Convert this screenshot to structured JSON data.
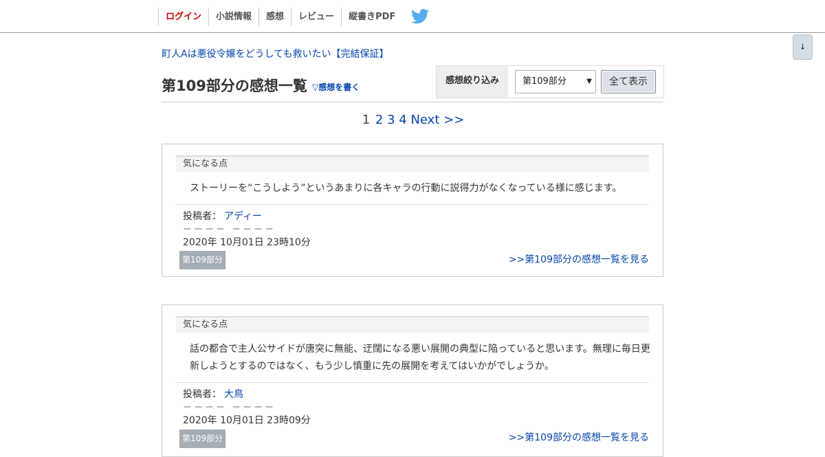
{
  "nav": {
    "items": [
      {
        "label": "ログイン"
      },
      {
        "label": "小説情報"
      },
      {
        "label": "感想"
      },
      {
        "label": "レビュー"
      },
      {
        "label": "縦書きPDF"
      }
    ]
  },
  "scroll_button": "↓",
  "novel_title": "町人Aは悪役令嬢をどうしても救いたい【完結保証】",
  "page_title": "第109部分の感想一覧",
  "write_link": "▽感想を書く",
  "filter": {
    "label": "感想絞り込み",
    "selected": "第109部分",
    "show_all": "全て表示"
  },
  "pager": {
    "current": "1",
    "pages": [
      "2",
      "3",
      "4"
    ],
    "next": "Next >>"
  },
  "comments": [
    {
      "section": "気になる点",
      "body": "ストーリーを“こうしよう”というあまりに各キャラの行動に説得力がなくなっている様に感じます。",
      "author_label": "投稿者：",
      "author": "アディー",
      "dashes": "－－－－ －－－－",
      "date": "2020年 10月01日 23時10分",
      "part": "第109部分",
      "view_link": ">>第109部分の感想一覧を見る"
    },
    {
      "section": "気になる点",
      "body": "話の都合で主人公サイドが唐突に無能、迂闊になる悪い展開の典型に陥っていると思います。無理に毎日更新しようとするのではなく、もう少し慎重に先の展開を考えてはいかがでしょうか。",
      "author_label": "投稿者：",
      "author": "大鳥",
      "dashes": "－－－－ －－－－",
      "date": "2020年 10月01日 23時09分",
      "part": "第109部分",
      "view_link": ">>第109部分の感想一覧を見る"
    }
  ],
  "colors": {
    "link": "#0645ad",
    "login": "#cc0000",
    "twitter": "#55acee",
    "badge": "#a4acb4"
  }
}
